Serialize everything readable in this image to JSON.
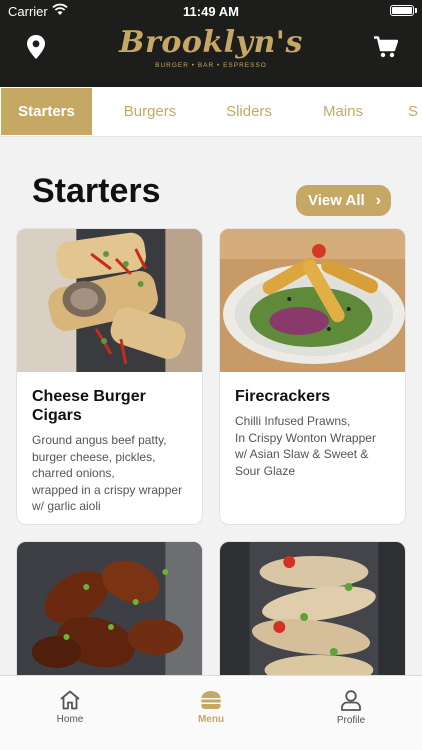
{
  "status_bar": {
    "carrier": "Carrier",
    "time": "11:49 AM"
  },
  "header": {
    "logo_name": "Brooklyn's",
    "logo_tagline": "BURGER • BAR • ESPRESSO",
    "location_icon": "map-pin-icon",
    "cart_icon": "cart-icon"
  },
  "tabs": [
    {
      "label": "Starters",
      "active": true
    },
    {
      "label": "Burgers",
      "active": false
    },
    {
      "label": "Sliders",
      "active": false
    },
    {
      "label": "Mains",
      "active": false
    },
    {
      "label": "S",
      "active": false
    }
  ],
  "section": {
    "title": "Starters",
    "view_all_label": "View All",
    "chevron": "›"
  },
  "cards": [
    {
      "title": "Cheese Burger Cigars",
      "description": "Ground angus beef patty,\nburger cheese, pickles,\ncharred onions,\nwrapped in a crispy wrapper\nw/ garlic aioli"
    },
    {
      "title": "Firecrackers",
      "description": "Chilli Infused Prawns,\nIn Crispy Wonton Wrapper\nw/ Asian Slaw & Sweet &\nSour Glaze"
    },
    {
      "title": "",
      "description": ""
    },
    {
      "title": "",
      "description": ""
    }
  ],
  "bottom_nav": [
    {
      "label": "Home",
      "icon": "home-icon",
      "active": false
    },
    {
      "label": "Menu",
      "icon": "burger-icon",
      "active": true
    },
    {
      "label": "Profile",
      "icon": "profile-icon",
      "active": false
    }
  ],
  "colors": {
    "accent": "#c6a865",
    "header_bg": "#1d1d1b"
  }
}
